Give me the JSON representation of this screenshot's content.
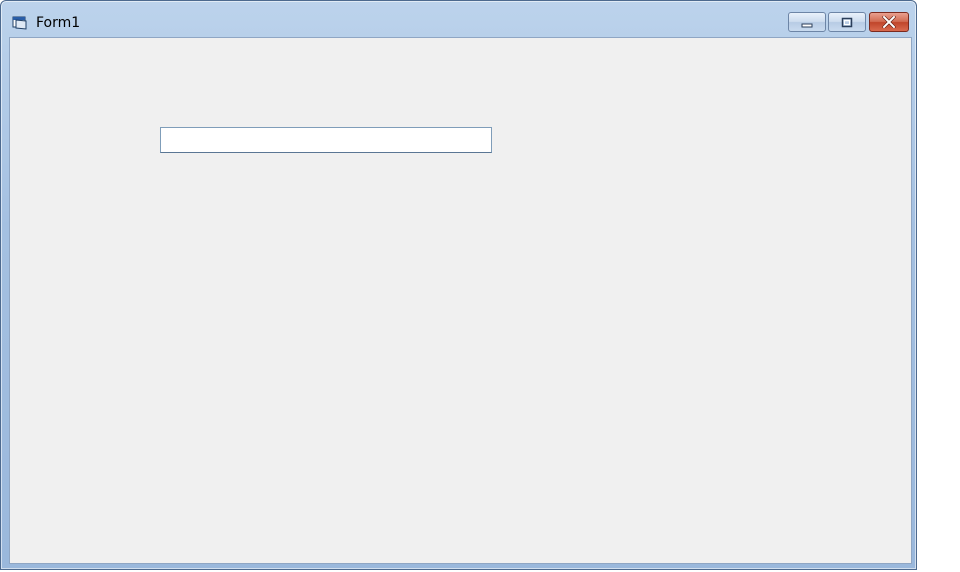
{
  "window": {
    "title": "Form1",
    "icon": "form-window-icon"
  },
  "caption_buttons": {
    "minimize": "minimize-icon",
    "maximize": "maximize-icon",
    "close": "close-icon"
  },
  "form": {
    "textbox_value": ""
  },
  "colors": {
    "client_background": "#f0f0f0",
    "titlebar": "#a4c0e1",
    "close_button": "#c0452a"
  }
}
